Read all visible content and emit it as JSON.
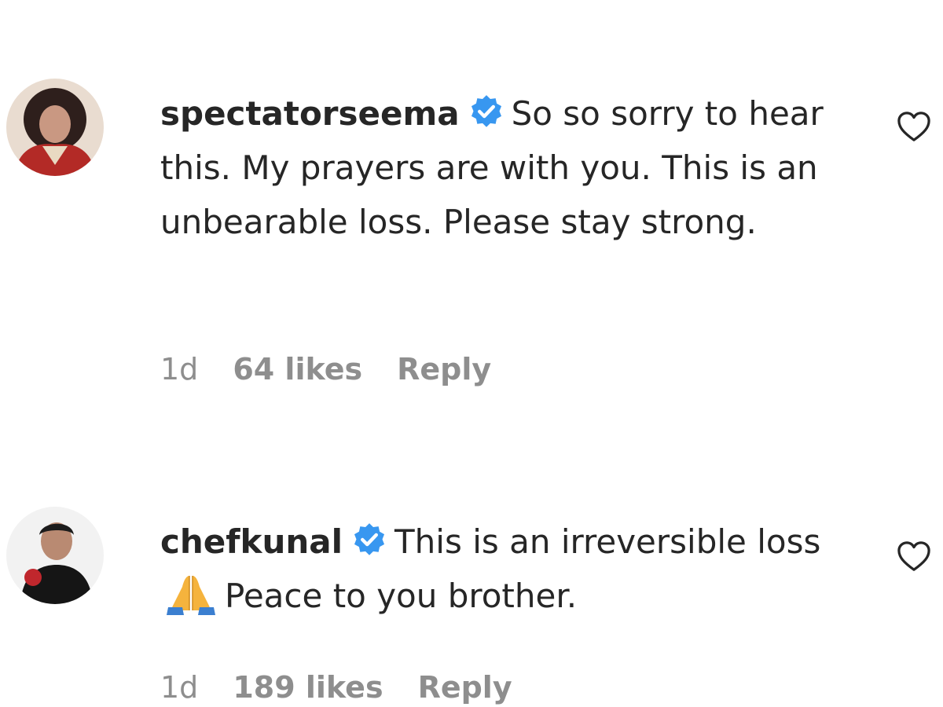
{
  "comments": [
    {
      "username": "spectatorseema",
      "verified": true,
      "text": "So so sorry to hear this. My prayers are with you. This is an unbearable loss. Please stay strong.",
      "time": "1d",
      "likes": "64 likes",
      "reply_label": "Reply",
      "like_icon": "heart-outline-icon",
      "avatar": "profile-photo"
    },
    {
      "username": "chefkunal",
      "verified": true,
      "text_before_emoji": "This is an irreversible loss",
      "emoji": "folded-hands",
      "text_after_emoji": "Peace to you brother.",
      "time": "1d",
      "likes": "189 likes",
      "reply_label": "Reply",
      "like_icon": "heart-outline-icon",
      "avatar": "profile-photo"
    }
  ],
  "colors": {
    "text": "#262626",
    "secondary": "#8e8e8e",
    "verified": "#3897f0"
  }
}
